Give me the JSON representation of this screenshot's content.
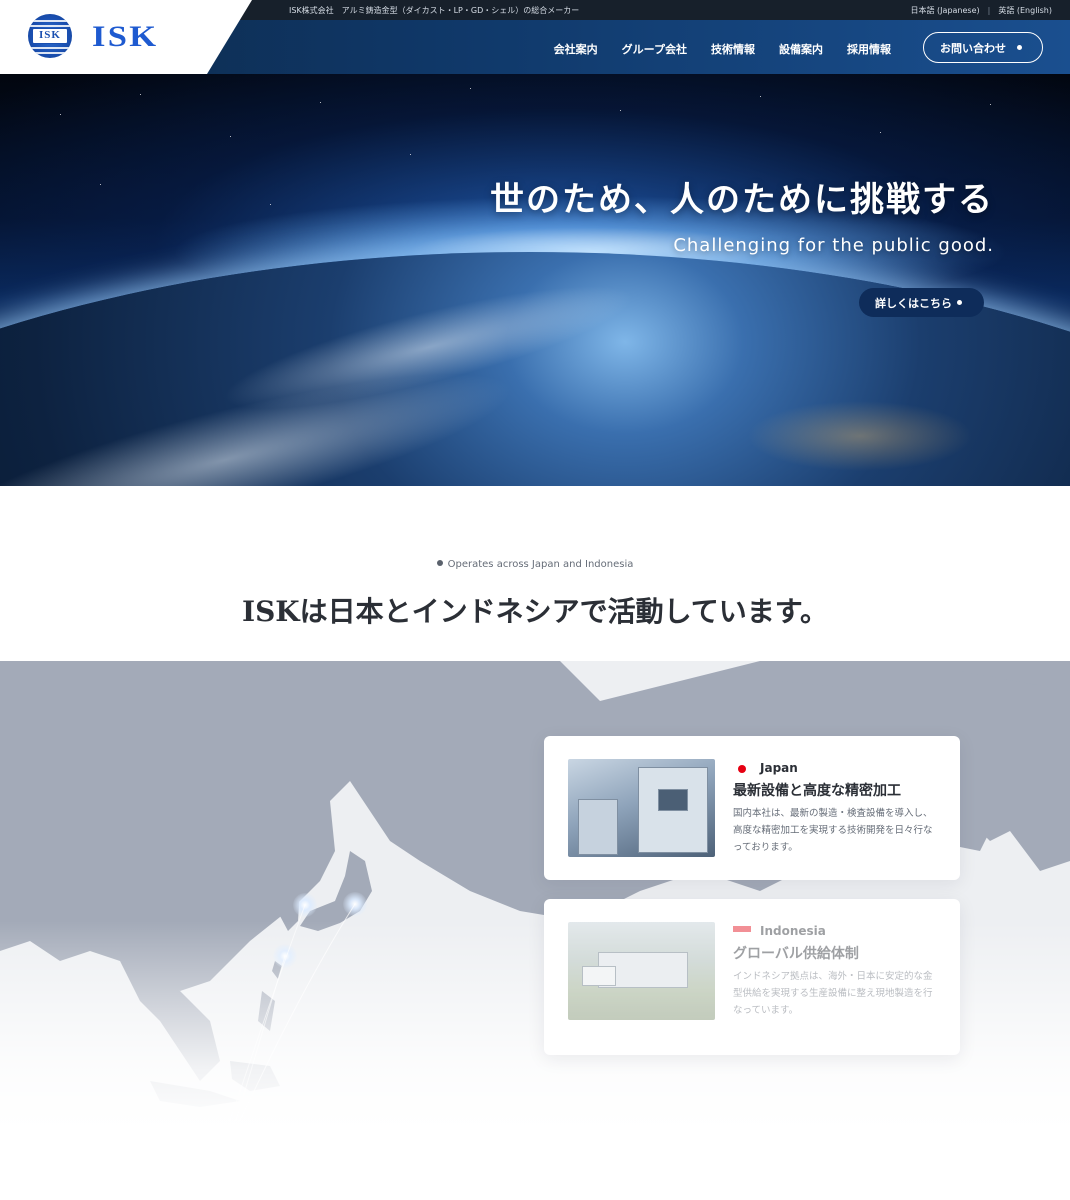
{
  "header": {
    "logo_badge": "ISK",
    "logo_text": "ISK",
    "tagline": "ISK株式会社　アルミ鋳造金型（ダイカスト・LP・GD・シェル）の総合メーカー",
    "lang_japanese": "日本語 (Japanese)",
    "lang_separator": "|",
    "lang_english": "英語 (English)",
    "nav": [
      "会社案内",
      "グループ会社",
      "技術情報",
      "設備案内",
      "採用情報"
    ],
    "contact_label": "お問い合わせ"
  },
  "hero": {
    "title": "世のため、人のために挑戦する",
    "subtitle": "Challenging for the public good.",
    "button_label": "詳しくはこちら"
  },
  "section": {
    "eyebrow": "Operates across Japan and Indonesia",
    "title": "ISKは日本とインドネシアで活動しています。"
  },
  "locations": [
    {
      "country": "Japan",
      "title": "最新設備と高度な精密加工",
      "description": "国内本社は、最新の製造・検査設備を導入し、高度な精密加工を実現する技術開発を日々行なっております。",
      "flag_icon": "japan-flag-icon",
      "active": true
    },
    {
      "country": "Indonesia",
      "title": "グローバル供給体制",
      "description": "インドネシア拠点は、海外・日本に安定的な金型供給を実現する生産設備に整え現地製造を行なっています。",
      "flag_icon": "indonesia-flag-icon",
      "active": false
    }
  ],
  "colors": {
    "brand_blue": "#1e5ad0",
    "header_navy": "#0f3767",
    "hero_button": "#0e2c5a",
    "map_land": "#a2a9b7"
  }
}
